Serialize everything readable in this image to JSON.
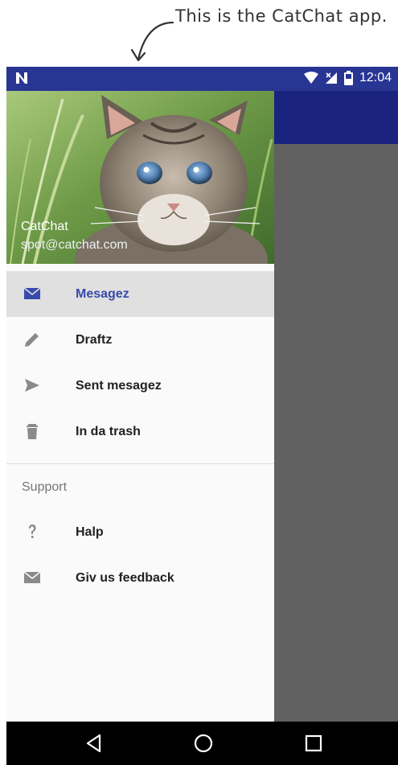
{
  "annotation": {
    "text": "This is the CatChat app."
  },
  "status_bar": {
    "time": "12:04"
  },
  "drawer": {
    "header": {
      "name": "CatChat",
      "email": "spot@catchat.com"
    },
    "items": [
      {
        "label": "Mesagez",
        "icon": "mail-icon",
        "selected": true
      },
      {
        "label": "Draftz",
        "icon": "pencil-icon"
      },
      {
        "label": "Sent mesagez",
        "icon": "send-icon"
      },
      {
        "label": "In da trash",
        "icon": "trash-icon"
      }
    ],
    "support_section": {
      "title": "Support",
      "items": [
        {
          "label": "Halp",
          "icon": "help-icon"
        },
        {
          "label": "Giv us feedback",
          "icon": "mail-icon"
        }
      ]
    }
  },
  "colors": {
    "status_bar": "#283593",
    "toolbar": "#1a237e",
    "accent": "#3949ab",
    "scrim": "#616161"
  }
}
